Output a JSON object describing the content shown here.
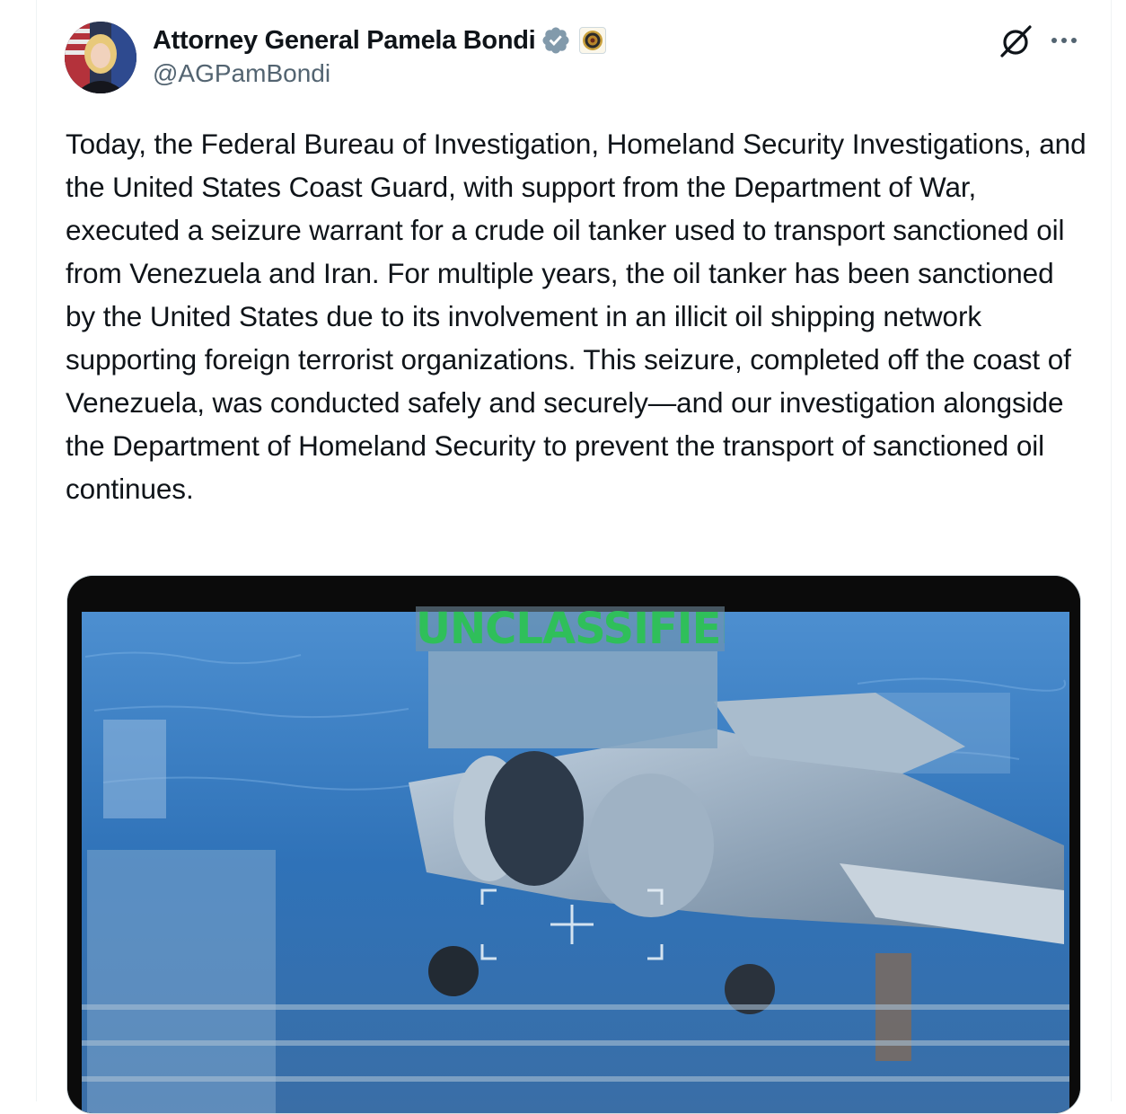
{
  "post": {
    "author": {
      "display_name": "Attorney General Pamela Bondi",
      "handle": "@AGPamBondi",
      "verified_icon": "verified-badge-icon",
      "affiliate_icon": "doj-seal-icon"
    },
    "actions": {
      "grok_icon": "grok-icon",
      "more_icon": "more-options-icon"
    },
    "text": "Today, the Federal Bureau of Investigation, Homeland Security Investigations, and the United States Coast Guard, with support from the Department of War, executed a seizure warrant for a crude oil tanker used to transport sanctioned oil from Venezuela and Iran. For multiple years, the oil tanker has been sanctioned by the United States due to its involvement in an illicit oil shipping network supporting foreign terrorist organizations. This seizure, completed off the coast of Venezuela, was conducted safely and securely—and our investigation alongside the Department of Homeland Security to prevent the transport of sanctioned oil continues.",
    "media": {
      "overlay_label": "UNCLASSIFIED"
    }
  },
  "colors": {
    "text": "#0f1419",
    "secondary": "#536471",
    "verified": "#829aab",
    "overlay_green": "#2fbf5a"
  }
}
